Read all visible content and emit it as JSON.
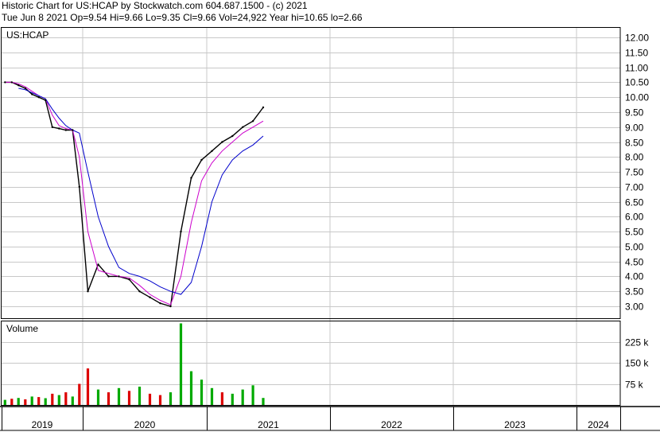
{
  "header": {
    "line1": "Historic Chart for US:HCAP by Stockwatch.com 604.687.1500 - (c) 2021",
    "line2": "Tue Jun  8 2021   Op=9.54  Hi=9.66  Lo=9.35  Cl=9.66  Vol=24,922  Year hi=10.65  lo=2.66"
  },
  "colors": {
    "price": "#000000",
    "ma_short": "#cc00cc",
    "ma_long": "#0000cc",
    "volume_up": "#00aa00",
    "volume_down": "#dd0000",
    "grid": "#c8c8c8",
    "frame": "#000000"
  },
  "chart_data": [
    {
      "type": "line",
      "title": "US:HCAP",
      "ylim": [
        2.6,
        12.35
      ],
      "y_ticks": [
        "12.00",
        "11.50",
        "11.00",
        "10.50",
        "10.00",
        "9.50",
        "9.00",
        "8.50",
        "8.00",
        "7.50",
        "7.00",
        "6.50",
        "6.00",
        "5.50",
        "5.00",
        "4.50",
        "4.00",
        "3.50",
        "3.00"
      ],
      "x_ticks": [
        "2019",
        "2020",
        "2021",
        "2022",
        "2023",
        "2024"
      ],
      "x": [
        "2019-01",
        "2019-02",
        "2019-03",
        "2019-04",
        "2019-05",
        "2019-06",
        "2019-07",
        "2019-08",
        "2019-09",
        "2019-10",
        "2019-11",
        "2019-12",
        "2020-01",
        "2020-02",
        "2020-03",
        "2020-04",
        "2020-05",
        "2020-06",
        "2020-07",
        "2020-08",
        "2020-09",
        "2020-10",
        "2020-11",
        "2020-12",
        "2021-01",
        "2021-02",
        "2021-03",
        "2021-04",
        "2021-05",
        "2021-06"
      ],
      "series": [
        {
          "values": [
            10.5,
            10.5,
            10.4,
            10.3,
            10.1,
            10.0,
            9.9,
            9.0,
            8.95,
            8.9,
            8.9,
            7.0,
            3.5,
            4.4,
            4.0,
            4.0,
            3.9,
            3.5,
            3.3,
            3.1,
            3.0,
            5.5,
            7.3,
            7.9,
            8.2,
            8.5,
            8.7,
            9.0,
            9.2,
            9.66
          ]
        },
        {
          "values": [
            10.5,
            10.5,
            10.45,
            10.35,
            10.2,
            10.05,
            9.95,
            9.4,
            9.05,
            8.95,
            8.9,
            8.0,
            5.5,
            4.2,
            4.1,
            4.0,
            3.95,
            3.7,
            3.4,
            3.2,
            3.05,
            4.0,
            5.8,
            7.2,
            7.8,
            8.2,
            8.5,
            8.8,
            9.0,
            9.2
          ]
        },
        {
          "values": [
            null,
            null,
            10.3,
            10.25,
            10.15,
            10.05,
            9.95,
            9.6,
            9.3,
            9.05,
            8.9,
            8.8,
            7.5,
            6.0,
            5.0,
            4.3,
            4.1,
            4.0,
            3.85,
            3.65,
            3.5,
            3.4,
            3.8,
            5.0,
            6.5,
            7.4,
            7.9,
            8.2,
            8.4,
            8.7
          ]
        }
      ]
    },
    {
      "type": "bar",
      "title": "Volume",
      "ylim": [
        0,
        300000
      ],
      "y_ticks": [
        "225 k",
        "150 k",
        "75 k"
      ],
      "x": [
        "2019-01",
        "2019-02",
        "2019-03",
        "2019-04",
        "2019-05",
        "2019-06",
        "2019-07",
        "2019-08",
        "2019-09",
        "2019-10",
        "2019-11",
        "2019-12",
        "2020-01",
        "2020-02",
        "2020-03",
        "2020-04",
        "2020-05",
        "2020-06",
        "2020-07",
        "2020-08",
        "2020-09",
        "2020-10",
        "2020-11",
        "2020-12",
        "2021-01",
        "2021-02",
        "2021-03",
        "2021-04",
        "2021-05",
        "2021-06"
      ],
      "values": [
        18000,
        22000,
        25000,
        20000,
        30000,
        28000,
        24000,
        40000,
        35000,
        45000,
        30000,
        75000,
        130000,
        55000,
        45000,
        60000,
        50000,
        65000,
        40000,
        35000,
        45000,
        290000,
        120000,
        90000,
        60000,
        45000,
        40000,
        55000,
        70000,
        25000
      ],
      "direction": [
        "up",
        "down",
        "up",
        "down",
        "up",
        "down",
        "up",
        "down",
        "up",
        "down",
        "up",
        "down",
        "down",
        "up",
        "down",
        "up",
        "down",
        "up",
        "down",
        "down",
        "up",
        "up",
        "up",
        "up",
        "up",
        "down",
        "up",
        "up",
        "up",
        "up"
      ]
    }
  ]
}
